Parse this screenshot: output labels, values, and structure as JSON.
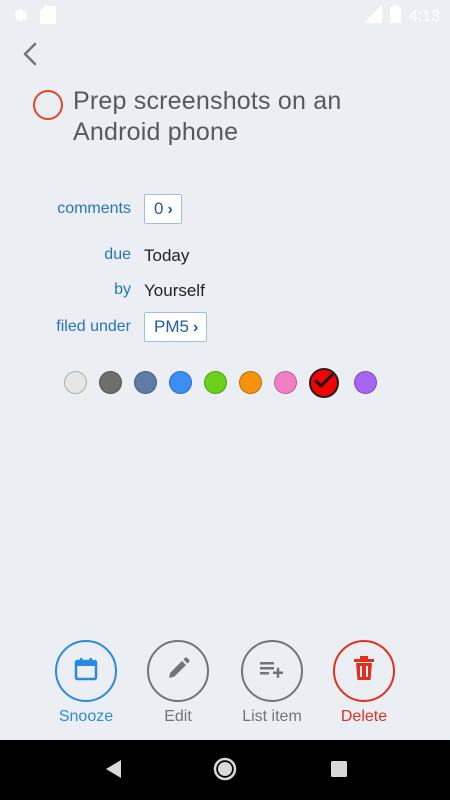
{
  "status_bar": {
    "time": "4:13",
    "icons": [
      "settings-icon",
      "sim-card-icon",
      "signal-icon",
      "battery-icon"
    ]
  },
  "nav": {
    "back_icon": "chevron-left-icon"
  },
  "task": {
    "title": "Prep screenshots on an Android phone",
    "complete_circle_color": "#e0452c"
  },
  "fields": {
    "comments": {
      "label": "comments",
      "value": "0"
    },
    "due": {
      "label": "due",
      "value": "Today"
    },
    "by": {
      "label": "by",
      "value": "Yourself"
    },
    "filed_under": {
      "label": "filed under",
      "value": "PM5"
    }
  },
  "colors": {
    "swatches": [
      "#e6e6e6",
      "#6e6e6e",
      "#5f7ca6",
      "#3a8ef5",
      "#6bd11b",
      "#f7920c",
      "#f27fc4",
      "#f50000",
      "#a666f0"
    ],
    "selected": "#f50000"
  },
  "actions": [
    {
      "label": "Snooze",
      "icon": "calendar-icon",
      "color": "#2a8ae0"
    },
    {
      "label": "Edit",
      "icon": "pencil-icon",
      "color": "#70757b"
    },
    {
      "label": "List item",
      "icon": "add-list-icon",
      "color": "#70757b"
    },
    {
      "label": "Delete",
      "icon": "trash-icon",
      "color": "#e0301e"
    }
  ],
  "system_nav": [
    "back-triangle-icon",
    "home-circle-icon",
    "recents-square-icon"
  ]
}
